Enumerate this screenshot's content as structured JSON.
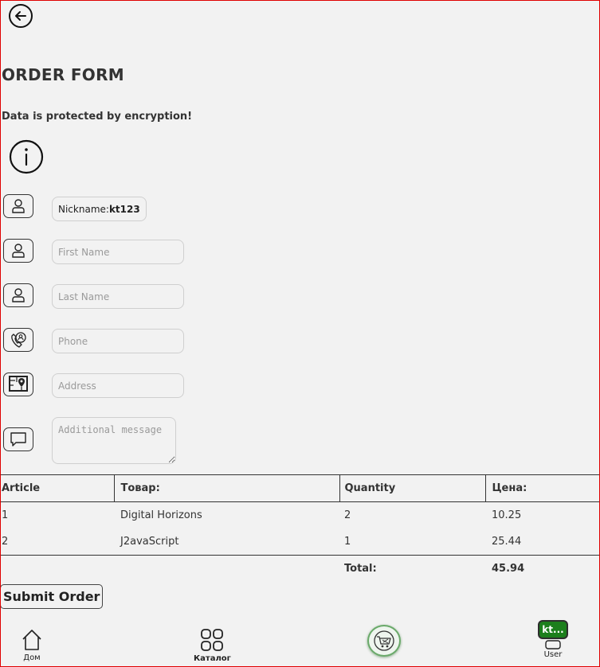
{
  "header": {
    "title": "ORDER FORM",
    "subtitle": "Data is protected by encryption!"
  },
  "form": {
    "nickname_label": "Nickname:",
    "nickname_value": "kt123",
    "first_name_placeholder": "First Name",
    "last_name_placeholder": "Last Name",
    "phone_placeholder": "Phone",
    "address_placeholder": "Address",
    "message_placeholder": "Additional message"
  },
  "table": {
    "headers": [
      "Article",
      "Товар:",
      "Quantity",
      "Цена:"
    ],
    "rows": [
      {
        "article": "1",
        "product": "Digital Horizons",
        "quantity": "2",
        "price": "10.25"
      },
      {
        "article": "2",
        "product": "J2avaScript",
        "quantity": "1",
        "price": "25.44"
      }
    ],
    "total_label": "Total:",
    "total_value": "45.94"
  },
  "submit_label": "Submit Order",
  "nav": {
    "home_label": "Дом",
    "catalog_label": "Каталог",
    "user_badge": "kt...",
    "user_label": "User"
  },
  "colors": {
    "background": "#f2f2f2",
    "user_badge": "#1c7f1c",
    "cart_ring": "#6aaa6a",
    "frame": "#e00000"
  },
  "icons": [
    "back-arrow-icon",
    "info-icon",
    "user-icon",
    "phone-contact-icon",
    "map-pin-icon",
    "chat-icon",
    "home-icon",
    "grid-icon",
    "cart-icon",
    "account-icon"
  ]
}
